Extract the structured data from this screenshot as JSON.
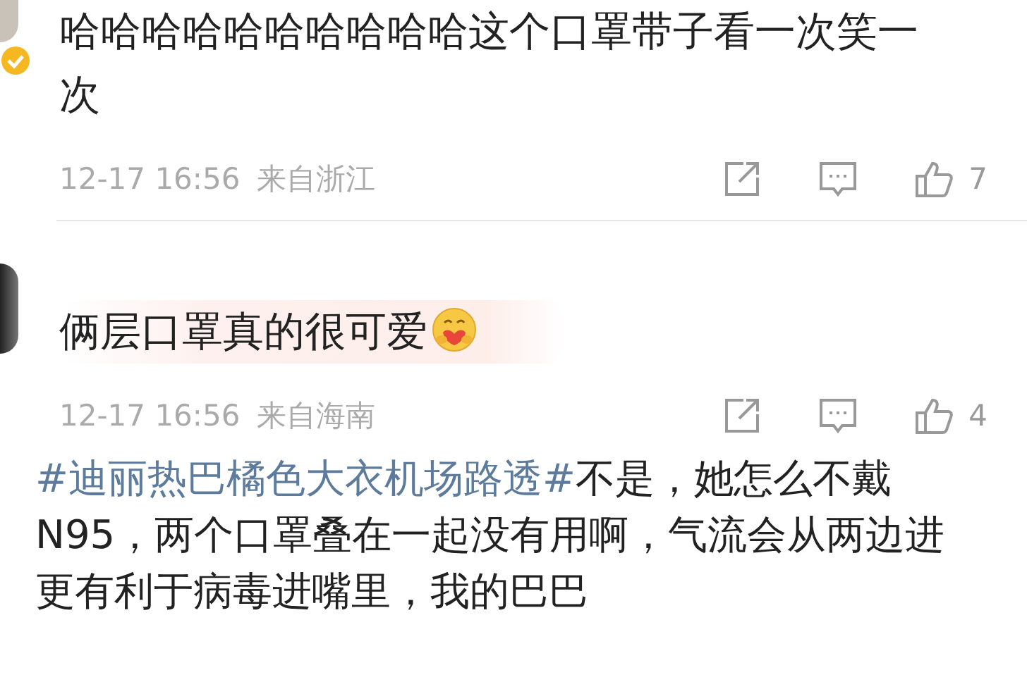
{
  "comments": [
    {
      "verified": true,
      "text": "哈哈哈哈哈哈哈哈哈哈这个口罩带子看一次笑一次",
      "time": "12-17 16:56",
      "location": "来自浙江",
      "likes": "7"
    },
    {
      "verified": false,
      "text": "俩层口罩真的很可爱",
      "emoji": true,
      "highlighted": true,
      "time": "12-17 16:56",
      "location": "来自海南",
      "likes": "4"
    }
  ],
  "reply": {
    "hashtag": "#迪丽热巴橘色大衣机场路透#",
    "text": "不是，她怎么不戴N95，两个口罩叠在一起没有用啊，气流会从两边进更有利于病毒进嘴里，我的巴巴"
  }
}
